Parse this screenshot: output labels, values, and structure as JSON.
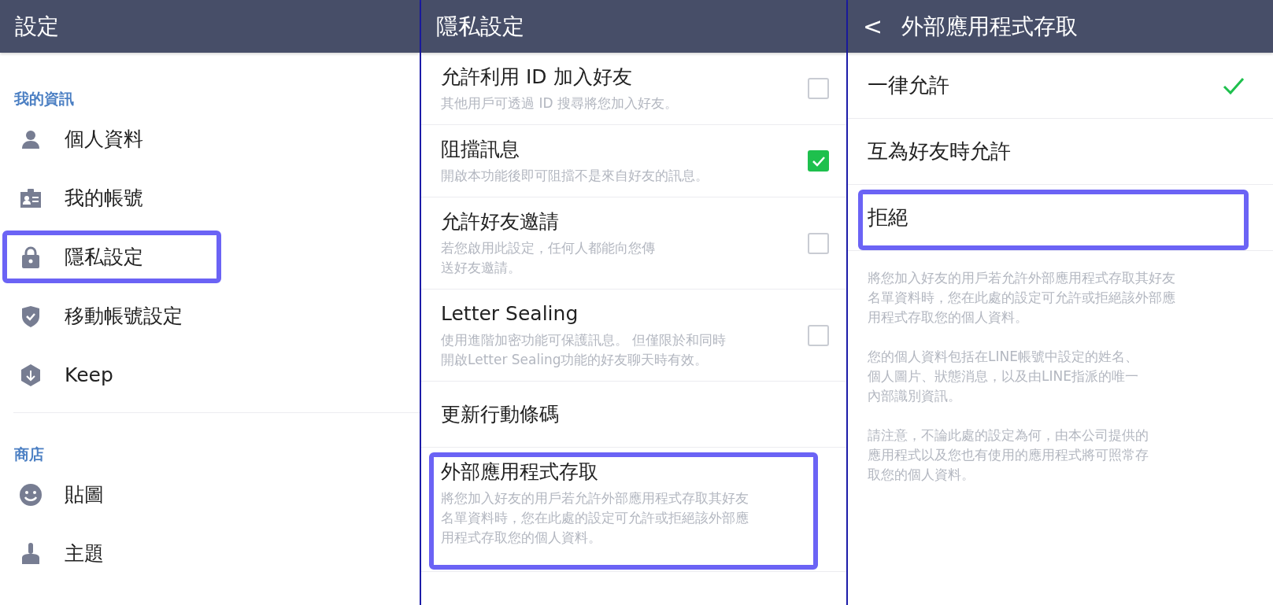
{
  "panels": [
    {
      "title": "設定",
      "sections": [
        {
          "label": "我的資訊",
          "items": [
            {
              "label": "個人資料",
              "highlighted": false
            },
            {
              "label": "我的帳號",
              "highlighted": false
            },
            {
              "label": "隱私設定",
              "highlighted": true
            },
            {
              "label": "移動帳號設定",
              "highlighted": false
            },
            {
              "label": "Keep",
              "highlighted": false
            }
          ]
        },
        {
          "label": "商店",
          "items": [
            {
              "label": "貼圖",
              "highlighted": false
            },
            {
              "label": "主題",
              "highlighted": false
            }
          ]
        }
      ]
    },
    {
      "title": "隱私設定",
      "rows": [
        {
          "kind": "checkbox",
          "title": "允許利用 ID 加入好友",
          "description": "其他用戶可透過 ID 搜尋將您加入好友。",
          "checked": false,
          "highlighted": false
        },
        {
          "kind": "checkbox",
          "title": "阻擋訊息",
          "description": "開啟本功能後即可阻擋不是來自好友的訊息。",
          "checked": true,
          "highlighted": false
        },
        {
          "kind": "checkbox",
          "title": "允許好友邀請",
          "description": "若您啟用此設定，任何人都能向您傳送好友邀請。",
          "checked": false,
          "highlighted": false
        },
        {
          "kind": "checkbox",
          "title": "Letter Sealing",
          "description": "使用進階加密功能可保護訊息。 但僅限於和同時開啟Letter Sealing功能的好友聊天時有效。",
          "checked": false,
          "highlighted": false
        },
        {
          "kind": "link",
          "title": "更新行動條碼",
          "highlighted": false
        },
        {
          "kind": "link",
          "title": "外部應用程式存取",
          "description": "將您加入好友的用戶若允許外部應用程式存取其好友名單資料時，您在此處的設定可允許或拒絕該外部應用程式存取您的個人資料。",
          "highlighted": true
        }
      ]
    },
    {
      "title": "外部應用程式存取",
      "back": "<",
      "options": [
        {
          "label": "一律允許",
          "selected": true,
          "highlighted": false
        },
        {
          "label": "互為好友時允許",
          "selected": false,
          "highlighted": false
        },
        {
          "label": "拒絕",
          "selected": false,
          "highlighted": true
        }
      ],
      "notes": [
        "將您加入好友的用戶若允許外部應用程式存取其好友名單資料時，您在此處的設定可允許或拒絕該外部應用程式存取您的個人資料。",
        "您的個人資料包括在LINE帳號中設定的姓名、個人圖片、狀態消息，以及由LINE指派的唯一內部識別資訊。",
        "請注意，不論此處的設定為何，由本公司提供的應用程式以及您也有使用的應用程式將可照常存取您的個人資料。"
      ]
    }
  ]
}
